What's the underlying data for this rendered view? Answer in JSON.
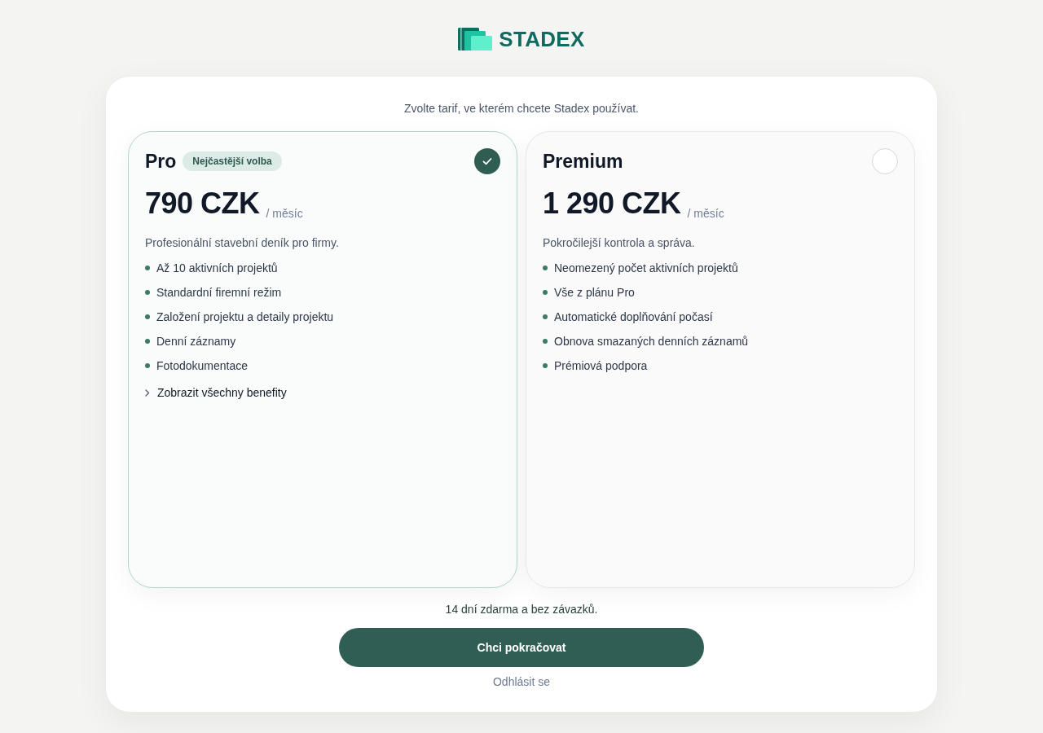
{
  "logo": {
    "name": "STADEX"
  },
  "subtitle": "Zvolte tarif, ve kterém chcete Stadex používat.",
  "plans": [
    {
      "name": "Pro",
      "badge": "Nejčastější volba",
      "price": "790 CZK",
      "period": "/ měsíc",
      "description": "Profesionální stavební deník pro firmy.",
      "features": [
        "Až 10 aktivních projektů",
        "Standardní firemní režim",
        "Založení projektu a detaily projektu",
        "Denní záznamy",
        "Fotodokumentace"
      ],
      "more_link": "Zobrazit všechny benefity",
      "selected": true
    },
    {
      "name": "Premium",
      "price": "1 290 CZK",
      "period": "/ měsíc",
      "description": "Pokročilejší kontrola a správa.",
      "features": [
        "Neomezený počet aktivních projektů",
        "Vše z plánu Pro",
        "Automatické doplňování počasí",
        "Obnova smazaných denních záznamů",
        "Prémiová podpora"
      ],
      "selected": false
    }
  ],
  "trial_note": "14 dní zdarma a bez závazků.",
  "continue_button": "Chci pokračovat",
  "logout_link": "Odhlásit se"
}
